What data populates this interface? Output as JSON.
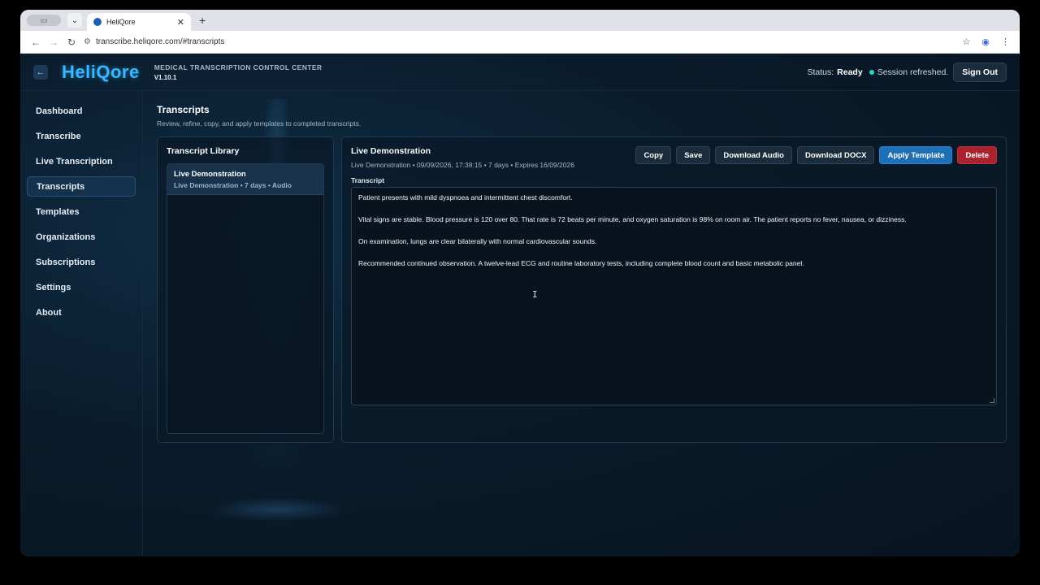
{
  "browser": {
    "tab_title": "HeliQore",
    "url": "transcribe.heliqore.com/#transcripts"
  },
  "header": {
    "logo": "HeliQore",
    "subtitle": "MEDICAL TRANSCRIPTION CONTROL CENTER",
    "version": "V1.10.1",
    "status_label": "Status:",
    "status_value": "Ready",
    "status_message": "Session refreshed.",
    "sign_out": "Sign Out"
  },
  "sidebar": {
    "items": [
      {
        "label": "Dashboard"
      },
      {
        "label": "Transcribe"
      },
      {
        "label": "Live Transcription"
      },
      {
        "label": "Transcripts"
      },
      {
        "label": "Templates"
      },
      {
        "label": "Organizations"
      },
      {
        "label": "Subscriptions"
      },
      {
        "label": "Settings"
      },
      {
        "label": "About"
      }
    ],
    "active": "Transcripts"
  },
  "page": {
    "title": "Transcripts",
    "description": "Review, refine, copy, and apply templates to completed transcripts."
  },
  "library": {
    "title": "Transcript Library",
    "items": [
      {
        "title": "Live Demonstration",
        "meta": "Live Demonstration • 7 days • Audio"
      }
    ]
  },
  "detail": {
    "title": "Live Demonstration",
    "meta": "Live Demonstration • 09/09/2026, 17:38:15 • 7 days • Expires 16/09/2026",
    "actions": {
      "copy": "Copy",
      "save": "Save",
      "download_audio": "Download Audio",
      "download_docx": "Download DOCX",
      "apply_template": "Apply Template",
      "delete": "Delete"
    },
    "transcript_label": "Transcript",
    "paragraphs": [
      "Patient presents with mild dyspnoea and intermittent chest discomfort.",
      "Vital signs are stable. Blood pressure is 120 over 80. That rate is 72 beats per minute, and oxygen saturation is 98% on room air. The patient reports no fever, nausea, or dizziness.",
      "On examination, lungs are clear bilaterally with normal cardiovascular sounds.",
      "Recommended continued observation. A twelve-lead ECG and routine laboratory tests, including complete blood count and basic metabolic panel."
    ]
  },
  "colors": {
    "accent": "#38b6ff",
    "primary_button": "#1f6fb5",
    "danger_button": "#a8232e",
    "status_dot": "#2ed3c6"
  }
}
